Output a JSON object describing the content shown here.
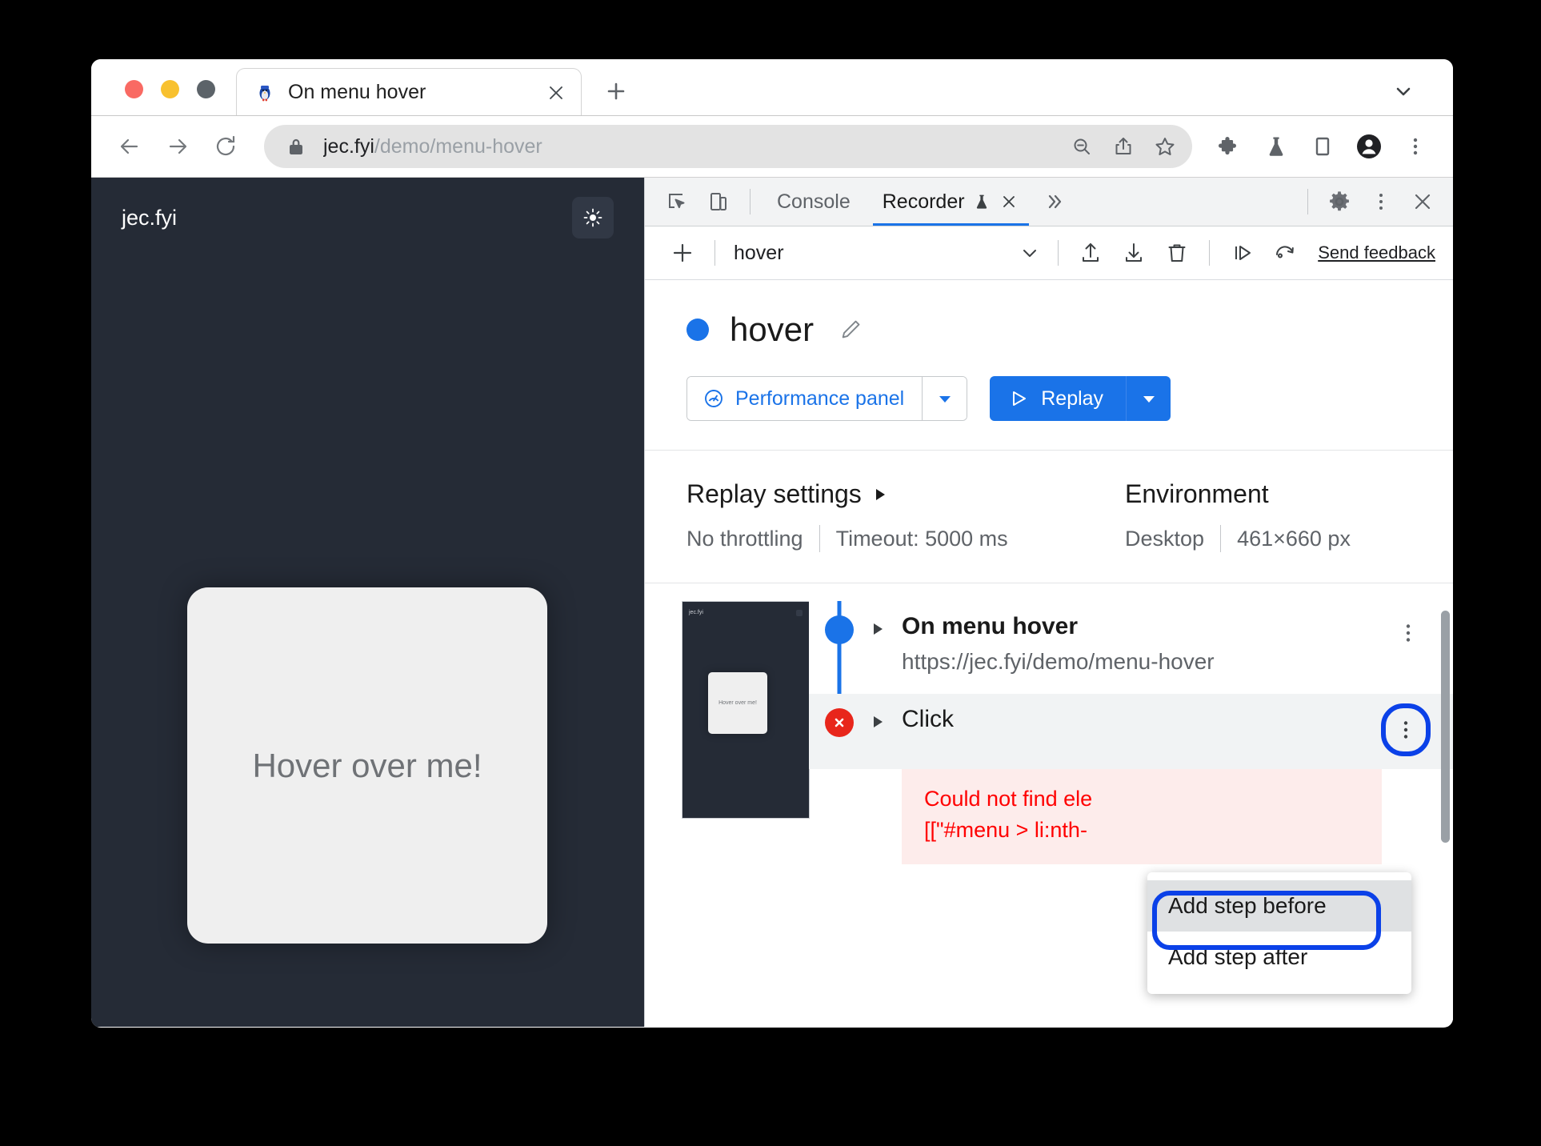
{
  "browser": {
    "tab": {
      "title": "On menu hover",
      "favicon_name": "penguin-favicon",
      "close_label": "×"
    },
    "new_tab_label": "+",
    "tab_search_name": "tab-search-chevron",
    "omnibox": {
      "url_host": "jec.fyi",
      "url_path": "/demo/menu-hover",
      "lock_icon": "lock-icon"
    },
    "toolbar_icons": [
      "zoom-out-icon",
      "share-icon",
      "bookmark-star-icon",
      "extensions-puzzle-icon",
      "experiments-flask-icon",
      "side-panel-icon",
      "profile-avatar-icon",
      "browser-menu-icon"
    ],
    "nav_icons": [
      "back-arrow-icon",
      "forward-arrow-icon",
      "reload-icon"
    ]
  },
  "page": {
    "logo": "jec.fyi",
    "theme_toggle_name": "sun-icon",
    "card_label": "Hover over me!"
  },
  "devtools": {
    "tabs": [
      {
        "label": "Console",
        "active": false
      },
      {
        "label": "Recorder",
        "active": true
      }
    ],
    "recorder_tab_flask": "experiment-flask-icon",
    "recorder_tab_close": "×",
    "more_tabs": "»",
    "right_icons": [
      "settings-gear-icon",
      "devtools-menu-icon",
      "close-devtools-icon"
    ],
    "left_icons": [
      "inspect-element-icon",
      "device-toolbar-icon"
    ]
  },
  "recorder": {
    "toolbar": {
      "add_label": "+",
      "recording_name": "hover",
      "chevron": "⌄",
      "export_icon": "export-icon",
      "import_icon": "import-icon",
      "delete_icon": "delete-trash-icon",
      "step_by_step_icon": "replay-step-icon",
      "replay_slow_icon": "replay-with-reload-icon",
      "feedback_label": "Send feedback"
    },
    "header": {
      "title": "hover",
      "status_dot_color": "#1a73e8",
      "edit_icon": "edit-pencil-icon",
      "perf_panel_label": "Performance panel",
      "perf_panel_icon": "performance-gauge-icon",
      "replay_label": "Replay",
      "replay_icon": "play-triangle-icon",
      "dropdown_caret": "▾"
    },
    "settings": {
      "replay_heading": "Replay settings",
      "replay_heading_caret": "▶",
      "throttling": "No throttling",
      "timeout": "Timeout: 5000 ms",
      "environment_heading": "Environment",
      "device": "Desktop",
      "viewport": "461×660 px"
    },
    "thumbnail": {
      "logo": "jec.fyi",
      "card_label": "Hover over me!"
    },
    "steps": [
      {
        "type": "navigate",
        "title": "On menu hover",
        "subtitle": "https://jec.fyi/demo/menu-hover",
        "marker": "start",
        "expander": "▶",
        "menu_icon": "step-menu-icon"
      },
      {
        "type": "click",
        "title": "Click",
        "marker": "error",
        "marker_glyph": "✕",
        "expander": "▶",
        "menu_icon": "step-menu-icon",
        "error_line1": "Could not find ele",
        "error_line2": "[[\"#menu > li:nth-"
      }
    ],
    "context_menu": {
      "items": [
        {
          "label": "Add step before",
          "selected": true
        },
        {
          "label": "Add step after",
          "selected": false
        }
      ]
    }
  },
  "colors": {
    "accent_blue": "#1a73e8",
    "highlight_blue": "#0b41e8",
    "error_red": "#e8261b",
    "error_text": "#ff0000",
    "page_bg": "#252b36"
  }
}
